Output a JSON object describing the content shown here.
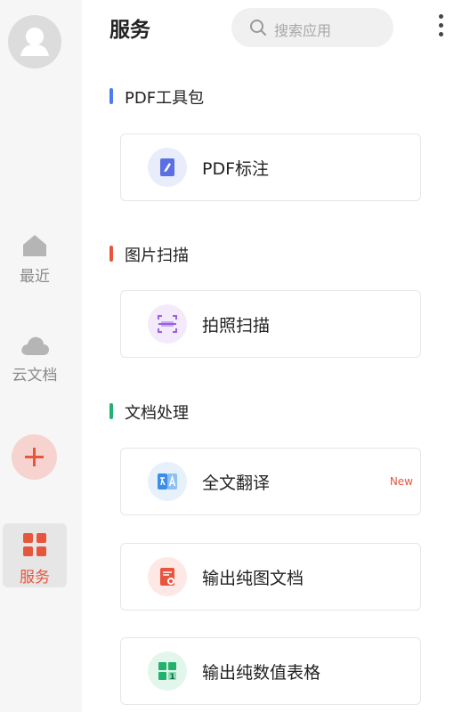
{
  "header": {
    "title": "服务",
    "search_placeholder": "搜索应用"
  },
  "sidebar": {
    "items": [
      {
        "label": "最近",
        "icon": "home-icon"
      },
      {
        "label": "云文档",
        "icon": "cloud-icon"
      },
      {
        "label": "服务",
        "icon": "grid-icon",
        "active": true
      }
    ],
    "add_icon": "plus-icon"
  },
  "sections": [
    {
      "title": "PDF工具包",
      "accent": "#4a7cf0",
      "cards": [
        {
          "label": "PDF标注",
          "icon": "pdf-annotate-icon",
          "color": "#5a6fe0"
        }
      ]
    },
    {
      "title": "图片扫描",
      "accent": "#e7553d",
      "cards": [
        {
          "label": "拍照扫描",
          "icon": "scan-icon",
          "color": "#9b5ee8"
        }
      ]
    },
    {
      "title": "文档处理",
      "accent": "#23b26d",
      "cards": [
        {
          "label": "全文翻译",
          "icon": "translate-icon",
          "color": "#3a8ee8",
          "badge": "New"
        },
        {
          "label": "输出纯图文档",
          "icon": "image-doc-icon",
          "color": "#e7553d"
        },
        {
          "label": "输出纯数值表格",
          "icon": "number-table-icon",
          "color": "#23b26d"
        }
      ]
    }
  ],
  "colors": {
    "accent_red": "#e7553d",
    "sidebar_bg": "#f6f6f6"
  }
}
